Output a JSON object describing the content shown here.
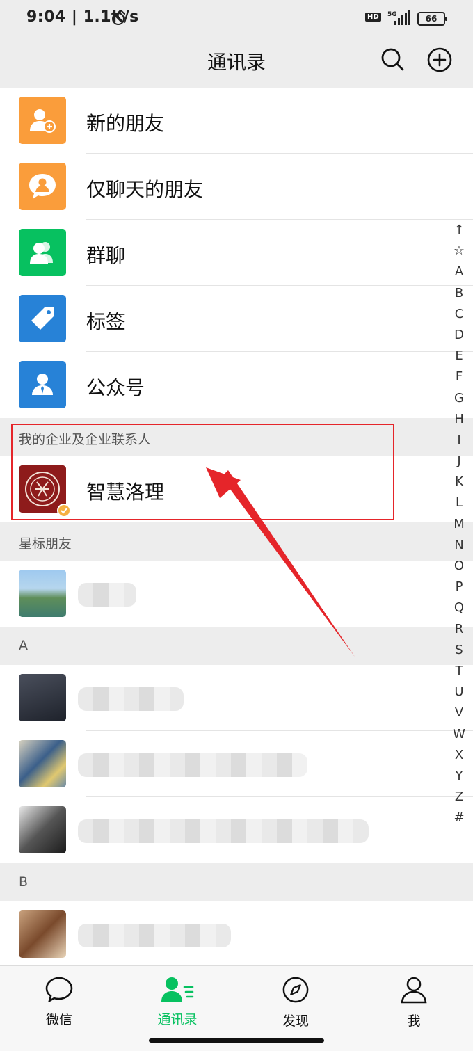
{
  "status_bar": {
    "time": "9:04 | 1.1K/s",
    "hd": "HD",
    "network": "5G",
    "battery": "66"
  },
  "header": {
    "title": "通讯录"
  },
  "menu_items": [
    {
      "label": "新的朋友",
      "color": "#fa9d3b",
      "icon": "add-friend-icon"
    },
    {
      "label": "仅聊天的朋友",
      "color": "#fa9d3b",
      "icon": "chat-only-friend-icon"
    },
    {
      "label": "群聊",
      "color": "#07c160",
      "icon": "group-chat-icon"
    },
    {
      "label": "标签",
      "color": "#2782d7",
      "icon": "tag-icon"
    },
    {
      "label": "公众号",
      "color": "#2782d7",
      "icon": "official-account-icon"
    }
  ],
  "sections": {
    "enterprise": "我的企业及企业联系人",
    "starred": "星标朋友",
    "a": "A",
    "b": "B"
  },
  "enterprise_contact": {
    "name": "智慧洛理"
  },
  "index_letters": [
    "↑",
    "☆",
    "A",
    "B",
    "C",
    "D",
    "E",
    "F",
    "G",
    "H",
    "I",
    "J",
    "K",
    "L",
    "M",
    "N",
    "O",
    "P",
    "Q",
    "R",
    "S",
    "T",
    "U",
    "V",
    "W",
    "X",
    "Y",
    "Z",
    "#"
  ],
  "tabs": [
    {
      "label": "微信",
      "icon": "chat-bubble-icon",
      "active": false
    },
    {
      "label": "通讯录",
      "icon": "contacts-icon",
      "active": true
    },
    {
      "label": "发现",
      "icon": "compass-icon",
      "active": false
    },
    {
      "label": "我",
      "icon": "person-icon",
      "active": false
    }
  ],
  "colors": {
    "accent": "#07c160",
    "annotation": "#e5252a"
  }
}
